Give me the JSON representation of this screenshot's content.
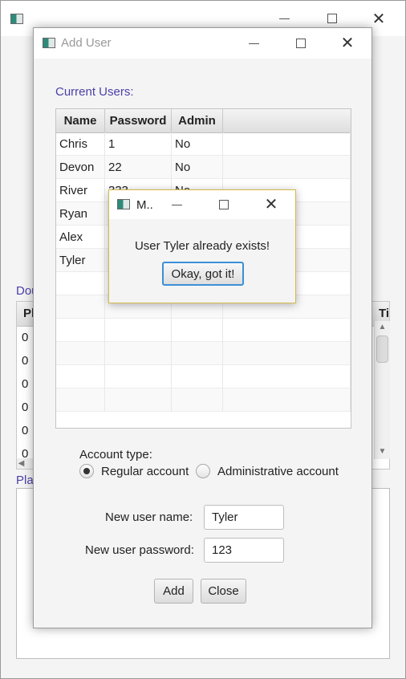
{
  "main_window": {
    "title_bar": {
      "minimize_icon": "minimize-icon",
      "maximize_icon": "maximize-icon",
      "close_glyph": "✕"
    },
    "label_partial": "Dou",
    "table_header_left": "Pl",
    "table_header_right": "Ti",
    "rows": [
      "0",
      "0",
      "0",
      "0",
      "0",
      "0"
    ],
    "label2_partial": "Play"
  },
  "add_user_dialog": {
    "title": "Add User",
    "close_glyph": "✕",
    "current_users_label": "Current Users:",
    "columns": [
      "Name",
      "Password",
      "Admin"
    ],
    "users": [
      {
        "name": "Chris",
        "password": "1",
        "admin": "No"
      },
      {
        "name": "Devon",
        "password": "22",
        "admin": "No"
      },
      {
        "name": "River",
        "password": "333",
        "admin": "No"
      },
      {
        "name": "Ryan",
        "password": "",
        "admin": ""
      },
      {
        "name": "Alex",
        "password": "",
        "admin": ""
      },
      {
        "name": "Tyler",
        "password": "",
        "admin": ""
      }
    ],
    "account_type_label": "Account type:",
    "regular_option": "Regular account",
    "admin_option": "Administrative account",
    "new_username_label": "New user name:",
    "new_username_value": "Tyler",
    "new_password_label": "New user password:",
    "new_password_value": "123",
    "add_button": "Add",
    "close_button": "Close"
  },
  "message_dialog": {
    "title": "M..",
    "close_glyph": "✕",
    "message": "User Tyler already exists!",
    "ok_button": "Okay, got it!"
  },
  "colors": {
    "accent_text": "#4b3fa8",
    "focus_border": "#3b8fd8",
    "message_border": "#d4b94a"
  }
}
